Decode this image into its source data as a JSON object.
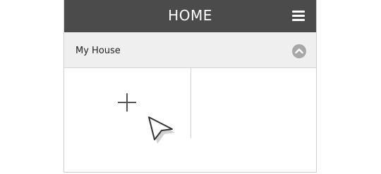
{
  "header": {
    "title": "HOME",
    "menu_icon": "hamburger-menu-icon"
  },
  "section": {
    "title": "My House",
    "collapse_icon": "chevron-up-icon"
  },
  "tiles": {
    "add_icon": "plus-icon",
    "cursor_icon": "mouse-pointer-icon"
  },
  "colors": {
    "header_bg": "#4b4b4b",
    "section_bg": "#efefef",
    "icon_gray": "#a8a8a8"
  }
}
